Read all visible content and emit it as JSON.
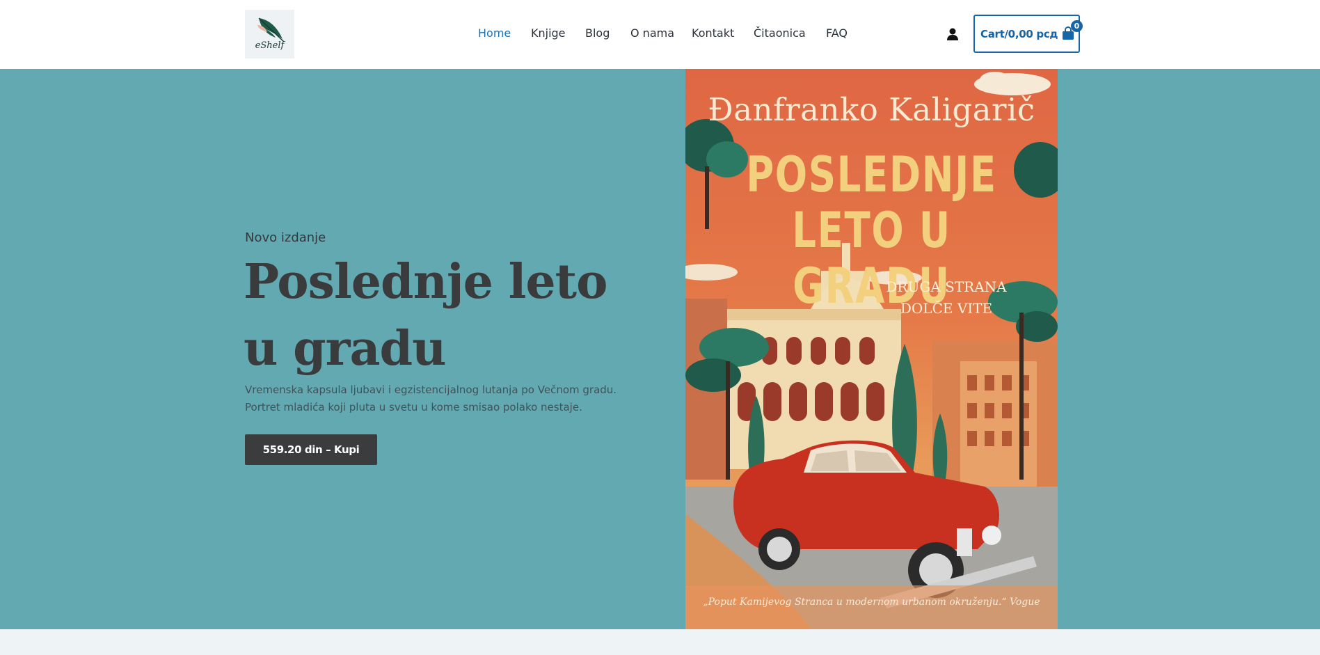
{
  "brand": {
    "logo_text": "eShelf",
    "logo_icon": "quill-feather-icon"
  },
  "nav": {
    "items": [
      {
        "label": "Home",
        "active": true
      },
      {
        "label": "Knjige",
        "active": false
      },
      {
        "label": "Blog",
        "active": false
      },
      {
        "label": "O nama",
        "active": false
      },
      {
        "label": "Kontakt",
        "active": false
      },
      {
        "label": "Čitaonica",
        "active": false
      },
      {
        "label": "FAQ",
        "active": false
      }
    ]
  },
  "header": {
    "account_icon": "user-icon",
    "cart": {
      "label": "Cart/0,00 рсд",
      "icon": "shopping-bag-icon",
      "count": "0"
    }
  },
  "hero": {
    "kicker": "Novo izdanje",
    "title": "Poslednje leto u gradu",
    "description_line1": "Vremenska kapsula ljubavi i egzistencijalnog lutanja po Večnom gradu.",
    "description_line2": "Portret mladića koji pluta u svetu u kome smisao polako nestaje.",
    "cta_label": "559.20 din – Kupi",
    "background_color": "#63a9b1"
  },
  "cover": {
    "author": "Đanfranko Kaligarič",
    "title_line1": "POSLEDNJE",
    "title_line2": "LETO U GRADU",
    "subtitle_line1": "DRUGA STRANA",
    "subtitle_line2": "DOLČE VITE",
    "quote": "„Poput Kamijevog Stranca u modernom urbanom okruženju.“ Vogue"
  },
  "colors": {
    "accent": "#1a72b8",
    "cart_border": "#1565a8",
    "button": "#3b3c3e",
    "text_dark": "#3a3b3d"
  }
}
